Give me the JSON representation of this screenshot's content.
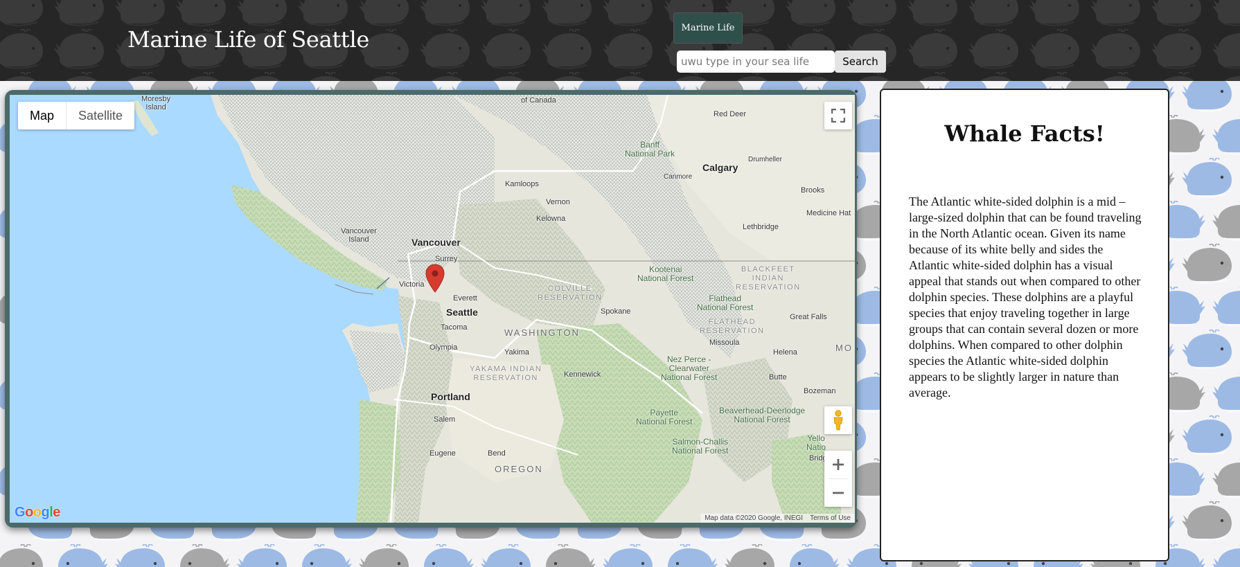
{
  "header": {
    "title": "Marine Life of Seattle",
    "nav_tab": "Marine Life",
    "search_placeholder": "uwu type in your sea life",
    "search_button": "Search"
  },
  "map": {
    "type_map": "Map",
    "type_satellite": "Satellite",
    "logo": "Google",
    "attribution": "Map data ©2020 Google, INEGI",
    "terms": "Terms of Use",
    "icons": [
      "fullscreen-icon",
      "pegman-icon",
      "zoom-in-icon",
      "zoom-out-icon",
      "map-marker-icon"
    ],
    "labels": {
      "moresby": "Moresby\nIsland",
      "of_canada": "of Canada",
      "red_deer": "Red Deer",
      "drumheller": "Drumheller",
      "banff": "Banff\nNational Park",
      "canmore": "Canmore",
      "calgary": "Calgary",
      "kamloops": "Kamloops",
      "vernon": "Vernon",
      "brooks": "Brooks",
      "medicine_hat": "Medicine Hat",
      "kelowna": "Kelowna",
      "lethbridge": "Lethbridge",
      "vancouver_island": "Vancouver\nIsland",
      "vancouver": "Vancouver",
      "surrey": "Surrey",
      "kootenai": "Kootenai\nNational Forest",
      "blackfeet": "BLACKFEET\nINDIAN\nRESERVATION",
      "victoria": "Victoria",
      "colville": "COLVILLE\nRESERVATION",
      "everett": "Everett",
      "flathead": "Flathead\nNational Forest",
      "seattle": "Seattle",
      "spokane": "Spokane",
      "great_falls": "Great Falls",
      "tacoma": "Tacoma",
      "washington": "WASHINGTON",
      "flathead_res": "FLATHEAD\nRESERVATION",
      "olympia": "Olympia",
      "missoula": "Missoula",
      "mo": "MO",
      "yakima": "Yakima",
      "helena": "Helena",
      "nez_perce": "Nez Perce -\nClearwater\nNational Forest",
      "yakama": "YAKAMA INDIAN\nRESERVATION",
      "kennewick": "Kennewick",
      "butte": "Butte",
      "portland": "Portland",
      "bozeman": "Bozeman",
      "payette": "Payette\nNational Forest",
      "beaverhead": "Beaverhead-Deerlodge\nNational Forest",
      "salem": "Salem",
      "salmon": "Salmon-Challis\nNational Forest",
      "yellow": "Yello\nNatio",
      "eugene": "Eugene",
      "bend": "Bend",
      "bridger": "Bridger-T",
      "oregon": "OREGON"
    }
  },
  "facts": {
    "title": "Whale Facts!",
    "body": "The Atlantic white-sided dolphin is a mid – large-sized dolphin that can be found traveling in the North Atlantic ocean. Given its name because of its white belly and sides the Atlantic white-sided dolphin has a visual appeal that stands out when compared to other dolphin species. These dolphins are a playful species that enjoy traveling together in large groups that can contain several dozen or more dolphins. When compared to other dolphin species the Atlantic white-sided dolphin appears to be slightly larger in nature than average."
  },
  "colors": {
    "header_bg": "#262626",
    "nav_tab_bg": "#2f4f4a",
    "map_frame": "#4b6a69",
    "water": "#aadaff",
    "whale_blue": "#8fb1e3",
    "whale_gray": "#9a9a9a"
  }
}
